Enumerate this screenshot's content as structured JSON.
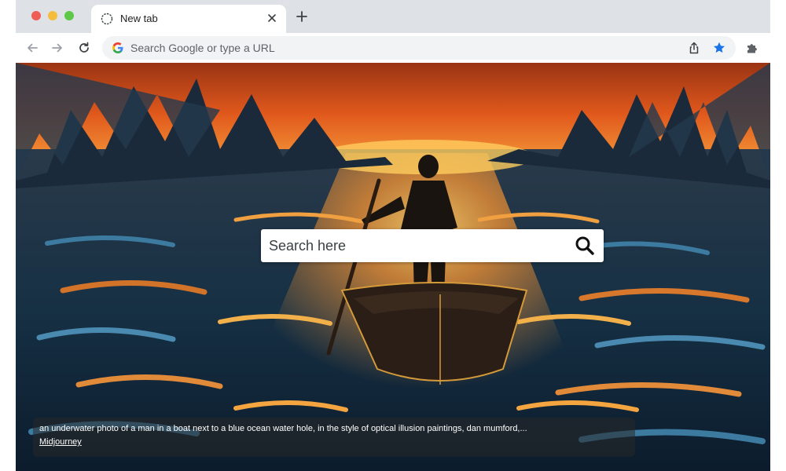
{
  "browser": {
    "tab": {
      "title": "New tab",
      "close_label": "×"
    },
    "newtab_label": "+",
    "omnibox": {
      "placeholder": "Search Google or type a URL"
    }
  },
  "page": {
    "search": {
      "placeholder": "Search here"
    },
    "caption": {
      "text": "an underwater photo of a man in a boat next to a blue ocean water hole, in the style of optical illusion paintings, dan mumford,...",
      "credit": "Midjourney"
    }
  },
  "colors": {
    "star": "#1a73e8",
    "tabstrip": "#dee1e6",
    "omnibox": "#f1f3f4"
  },
  "icons": [
    "back-arrow-icon",
    "forward-arrow-icon",
    "reload-icon",
    "google-logo-icon",
    "share-icon",
    "star-icon",
    "puzzle-extension-icon",
    "search-icon",
    "close-icon",
    "plus-icon"
  ]
}
